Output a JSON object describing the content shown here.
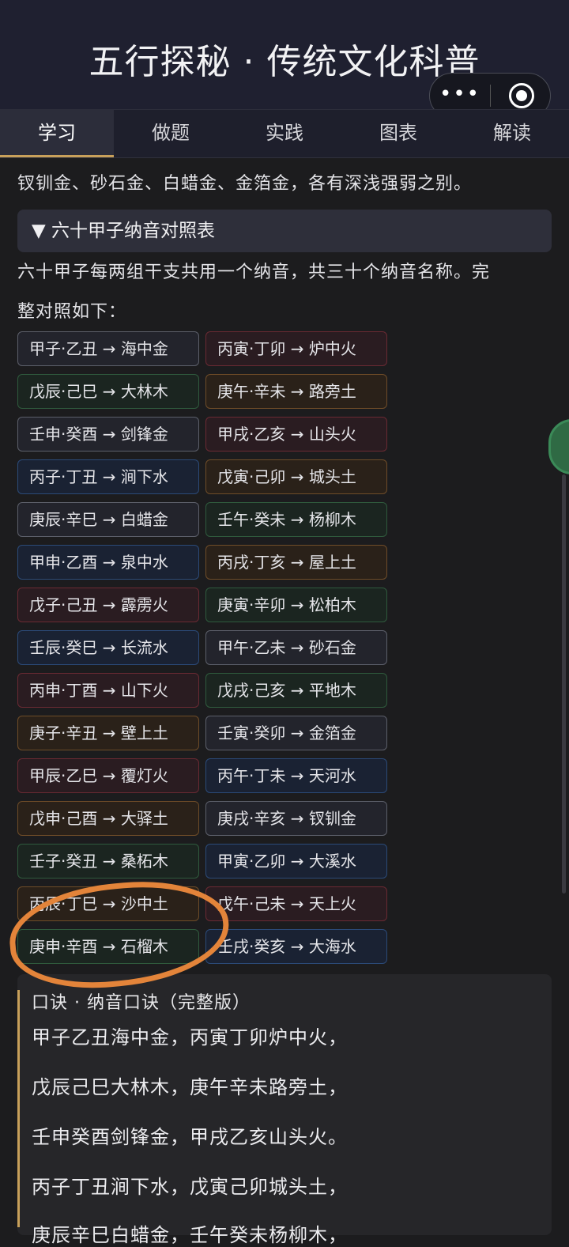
{
  "header": {
    "title": "五行探秘 · 传统文化科普",
    "more_label": "•••"
  },
  "tabs": [
    {
      "label": "学习",
      "active": true
    },
    {
      "label": "做题",
      "active": false
    },
    {
      "label": "实践",
      "active": false
    },
    {
      "label": "图表",
      "active": false
    },
    {
      "label": "解读",
      "active": false
    }
  ],
  "intro_line": "钗钏金、砂石金、白蜡金、金箔金，各有深浅强弱之别。",
  "section": {
    "summary": "▼ 六十甲子纳音对照表",
    "description_line1": "六十甲子每两组干支共用一个纳音，共三十个纳音名称。完",
    "description_line2": "整对照如下："
  },
  "pairs": [
    {
      "text": "甲子·乙丑 → 海中金",
      "element": "jin"
    },
    {
      "text": "丙寅·丁卯 → 炉中火",
      "element": "huo"
    },
    {
      "text": "戊辰·己巳 → 大林木",
      "element": "mu"
    },
    {
      "text": "庚午·辛未 → 路旁土",
      "element": "tu"
    },
    {
      "text": "壬申·癸酉 → 剑锋金",
      "element": "jin"
    },
    {
      "text": "甲戌·乙亥 → 山头火",
      "element": "huo"
    },
    {
      "text": "丙子·丁丑 → 涧下水",
      "element": "shui"
    },
    {
      "text": "戊寅·己卯 → 城头土",
      "element": "tu"
    },
    {
      "text": "庚辰·辛巳 → 白蜡金",
      "element": "jin"
    },
    {
      "text": "壬午·癸未 → 杨柳木",
      "element": "mu"
    },
    {
      "text": "甲申·乙酉 → 泉中水",
      "element": "shui"
    },
    {
      "text": "丙戌·丁亥 → 屋上土",
      "element": "tu"
    },
    {
      "text": "戊子·己丑 → 霹雳火",
      "element": "huo"
    },
    {
      "text": "庚寅·辛卯 → 松柏木",
      "element": "mu"
    },
    {
      "text": "壬辰·癸巳 → 长流水",
      "element": "shui"
    },
    {
      "text": "甲午·乙未 → 砂石金",
      "element": "jin"
    },
    {
      "text": "丙申·丁酉 → 山下火",
      "element": "huo"
    },
    {
      "text": "戊戌·己亥 → 平地木",
      "element": "mu"
    },
    {
      "text": "庚子·辛丑 → 壁上土",
      "element": "tu"
    },
    {
      "text": "壬寅·癸卯 → 金箔金",
      "element": "jin"
    },
    {
      "text": "甲辰·乙巳 → 覆灯火",
      "element": "huo"
    },
    {
      "text": "丙午·丁未 → 天河水",
      "element": "shui"
    },
    {
      "text": "戊申·己酉 → 大驿土",
      "element": "tu"
    },
    {
      "text": "庚戌·辛亥 → 钗钏金",
      "element": "jin"
    },
    {
      "text": "壬子·癸丑 → 桑柘木",
      "element": "mu"
    },
    {
      "text": "甲寅·乙卯 → 大溪水",
      "element": "shui"
    },
    {
      "text": "丙辰·丁巳 → 沙中土",
      "element": "tu"
    },
    {
      "text": "戊午·己未 → 天上火",
      "element": "huo"
    },
    {
      "text": "庚申·辛酉 → 石榴木",
      "element": "mu"
    },
    {
      "text": "壬戌·癸亥 → 大海水",
      "element": "shui"
    }
  ],
  "verse": {
    "title": "口诀 · 纳音口诀（完整版）",
    "lines": [
      "甲子乙丑海中金，丙寅丁卯炉中火，",
      "戊辰己巳大林木，庚午辛未路旁土，",
      "壬申癸酉剑锋金，甲戌乙亥山头火。",
      "丙子丁丑涧下水，戊寅己卯城头土，",
      "庚辰辛巳白蜡金，壬午癸未杨柳木，"
    ]
  },
  "colors": {
    "accent": "#c8a05a",
    "annotation": "#e3843a",
    "jin": "#5c5f6a",
    "mu": "#2f5a3d",
    "shui": "#2b4a78",
    "huo": "#6a2a33",
    "tu": "#6e4c28"
  }
}
